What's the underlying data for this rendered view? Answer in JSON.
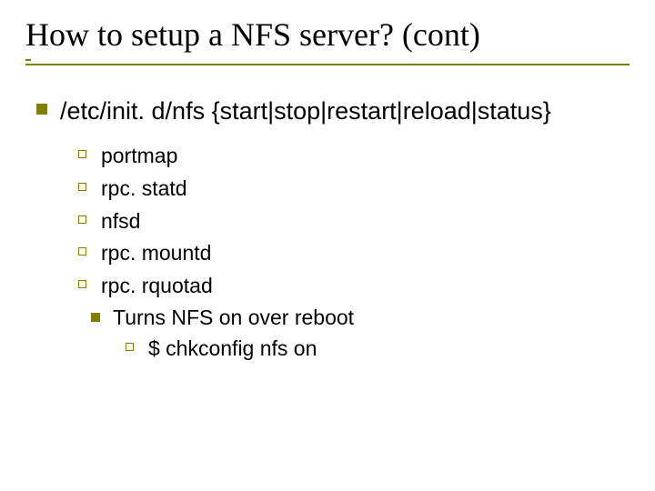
{
  "title": "How to setup a NFS server? (cont)",
  "point1": "/etc/init. d/nfs {start|stop|restart|reload|status}",
  "sub": {
    "a": "portmap",
    "b": "rpc. statd",
    "c": "nfsd",
    "d": "rpc. mountd",
    "e": "rpc. rquotad"
  },
  "point2": "Turns NFS on over reboot",
  "sub2": {
    "a": "$ chkconfig nfs on"
  }
}
